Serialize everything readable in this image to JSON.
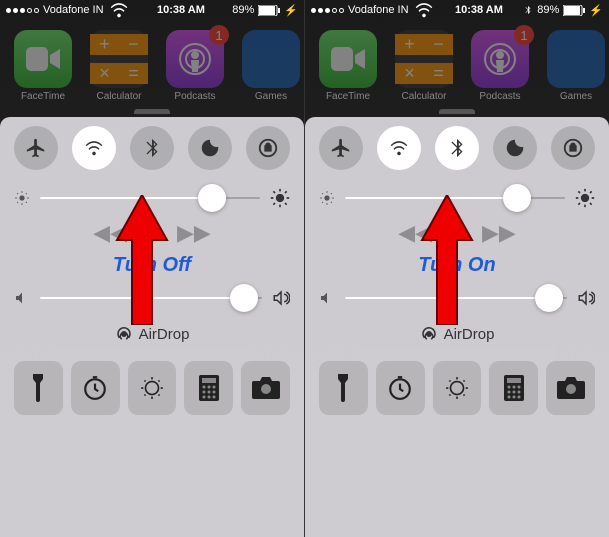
{
  "left": {
    "status": {
      "carrier": "Vodafone IN",
      "time": "10:38 AM",
      "battery": "89%"
    },
    "apps": {
      "facetime": "FaceTime",
      "calculator": "Calculator",
      "podcasts": "Podcasts",
      "games": "Games",
      "badge": "1"
    },
    "bluetooth_on": false,
    "caption": "Turn Off",
    "airdrop": "AirDrop"
  },
  "right": {
    "status": {
      "carrier": "Vodafone IN",
      "time": "10:38 AM",
      "battery": "89%"
    },
    "apps": {
      "facetime": "FaceTime",
      "calculator": "Calculator",
      "podcasts": "Podcasts",
      "games": "Games",
      "badge": "1"
    },
    "bluetooth_on": true,
    "caption": "Turn On",
    "airdrop": "AirDrop"
  }
}
